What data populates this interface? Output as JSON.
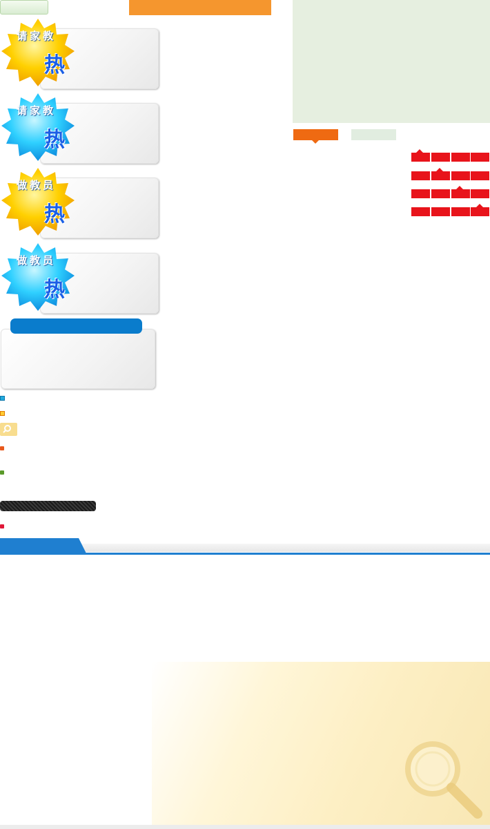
{
  "badges": [
    {
      "label": "请家教",
      "hot": "热",
      "color": "yellow"
    },
    {
      "label": "请家教",
      "hot": "热",
      "color": "blue"
    },
    {
      "label": "做教员",
      "hot": "热",
      "color": "yellow"
    },
    {
      "label": "做教员",
      "hot": "热",
      "color": "blue"
    }
  ],
  "colors": {
    "orange_bar": "#f5962e",
    "tab_active": "#ef6a12",
    "red_cell": "#e8141b",
    "nav_blue": "#1f7fd0",
    "header_blue": "#0a7ccc",
    "panel_green": "#e6efe0"
  },
  "icons": {
    "search": "search-icon",
    "magnifier": "magnifier-icon"
  }
}
